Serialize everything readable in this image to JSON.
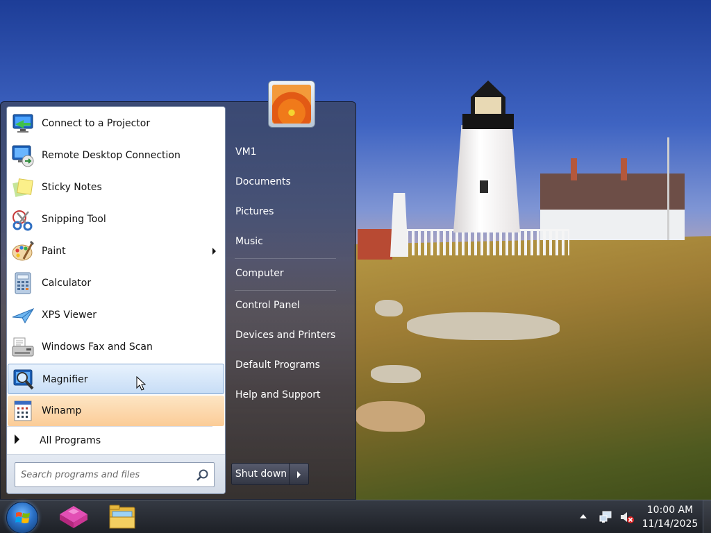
{
  "start_menu": {
    "programs": [
      {
        "label": "Connect to a Projector",
        "icon": "projector-icon"
      },
      {
        "label": "Remote Desktop Connection",
        "icon": "remote-desktop-icon"
      },
      {
        "label": "Sticky Notes",
        "icon": "sticky-notes-icon"
      },
      {
        "label": "Snipping Tool",
        "icon": "scissors-icon"
      },
      {
        "label": "Paint",
        "icon": "paint-palette-icon",
        "has_submenu": true
      },
      {
        "label": "Calculator",
        "icon": "calculator-icon"
      },
      {
        "label": "XPS Viewer",
        "icon": "xps-viewer-icon"
      },
      {
        "label": "Windows Fax and Scan",
        "icon": "fax-scanner-icon"
      },
      {
        "label": "Magnifier",
        "icon": "magnifier-icon",
        "state": "hovered"
      },
      {
        "label": "Winamp",
        "icon": "winamp-icon",
        "state": "pinned-highlight"
      }
    ],
    "all_programs_label": "All Programs",
    "search": {
      "placeholder": "Search programs and files",
      "value": ""
    },
    "right_items": [
      {
        "label": "VM1"
      },
      {
        "label": "Documents"
      },
      {
        "label": "Pictures"
      },
      {
        "label": "Music"
      },
      {
        "label": "Computer"
      },
      {
        "label": "Control Panel"
      },
      {
        "label": "Devices and Printers"
      },
      {
        "label": "Default Programs"
      },
      {
        "label": "Help and Support"
      }
    ],
    "shutdown_label": "Shut down",
    "user_picture": "flower-user-picture"
  },
  "taskbar": {
    "pinned_apps": [
      {
        "icon": "winamp-taskbar-icon"
      },
      {
        "icon": "file-explorer-icon"
      }
    ],
    "tray_icons": [
      "show-hidden-icons-arrow",
      "network-icon",
      "volume-muted-icon"
    ],
    "clock": {
      "time": "10:00 AM",
      "date": "11/14/2025"
    }
  },
  "colors": {
    "hover_highlight": "#c7ddf6",
    "pinned_highlight": "#fbcc97",
    "start_menu_glass": "#3c4664",
    "taskbar": "#1c1f26"
  }
}
